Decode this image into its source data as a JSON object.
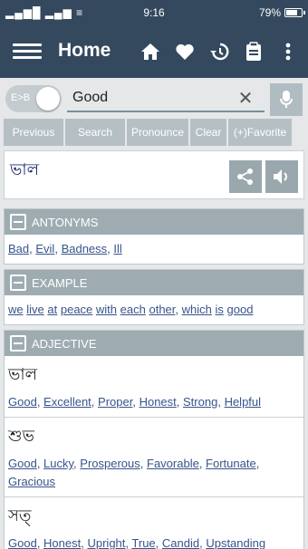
{
  "status": {
    "signal": "▂▄▆█ ▂▄▆ ≡",
    "time": "9:16",
    "battery": "79%",
    "battery_level": 0.79
  },
  "appbar": {
    "title": "Home"
  },
  "search": {
    "mode": "E>B",
    "value": "Good"
  },
  "buttons": [
    "Previous",
    "Search",
    "Pronounce",
    "Clear",
    "(+)Favorite"
  ],
  "word": {
    "bengali": "ভাল"
  },
  "antonyms": {
    "title": "ANTONYMS",
    "items": [
      "Bad",
      "Evil",
      "Badness",
      "Ill"
    ]
  },
  "example": {
    "title": "EXAMPLE",
    "items": [
      "we",
      "live",
      "at",
      "peace",
      "with",
      "each",
      "other",
      "which",
      "is",
      "good"
    ]
  },
  "adjective": {
    "title": "ADJECTIVE",
    "entries": [
      {
        "word": "ভাল",
        "items": [
          "Good",
          "Excellent",
          "Proper",
          "Honest",
          "Strong",
          "Helpful"
        ]
      },
      {
        "word": "শুভ",
        "items": [
          "Lucky",
          "Prosperous",
          "Favorable",
          "Fortunate",
          "Gracious"
        ],
        "lead": "Good"
      },
      {
        "word": "সত্",
        "items": [
          "Good",
          "Honest",
          "Upright",
          "True",
          "Candid",
          "Upstanding"
        ]
      }
    ]
  }
}
